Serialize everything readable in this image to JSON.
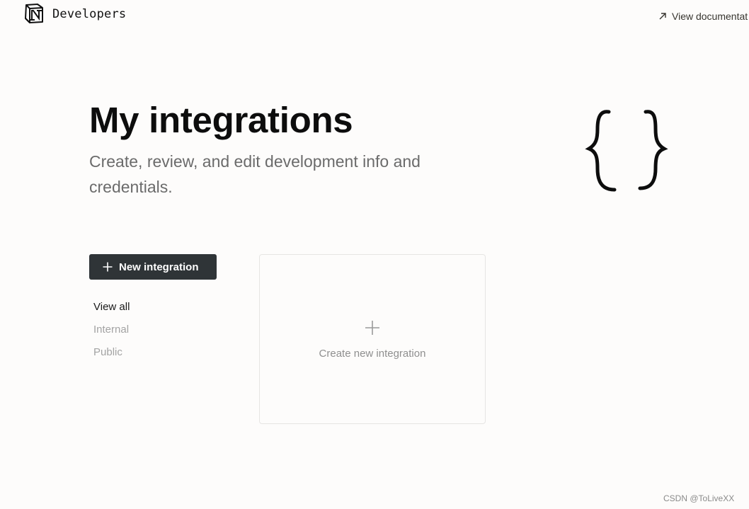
{
  "header": {
    "brand": "Developers",
    "doc_link_label": "View documentat",
    "logo_icon": "notion-logo-icon",
    "doc_link_icon": "arrow-up-right-icon"
  },
  "hero": {
    "title": "My integrations",
    "subtitle": "Create, review, and edit development info and credentials.",
    "illustration_icon": "curly-braces-icon"
  },
  "actions": {
    "new_integration_label": "New integration",
    "new_integration_icon": "plus-icon"
  },
  "filters": {
    "items": [
      {
        "label": "View all",
        "active": true
      },
      {
        "label": "Internal",
        "active": false
      },
      {
        "label": "Public",
        "active": false
      }
    ]
  },
  "create_card": {
    "label": "Create new integration",
    "icon": "plus-icon"
  },
  "watermark": "CSDN @ToLiveXX",
  "colors": {
    "background": "#fdfcfb",
    "button_bg": "#2f3437",
    "muted_text": "#6b6b6b",
    "inactive_filter": "#a3a3a3"
  }
}
